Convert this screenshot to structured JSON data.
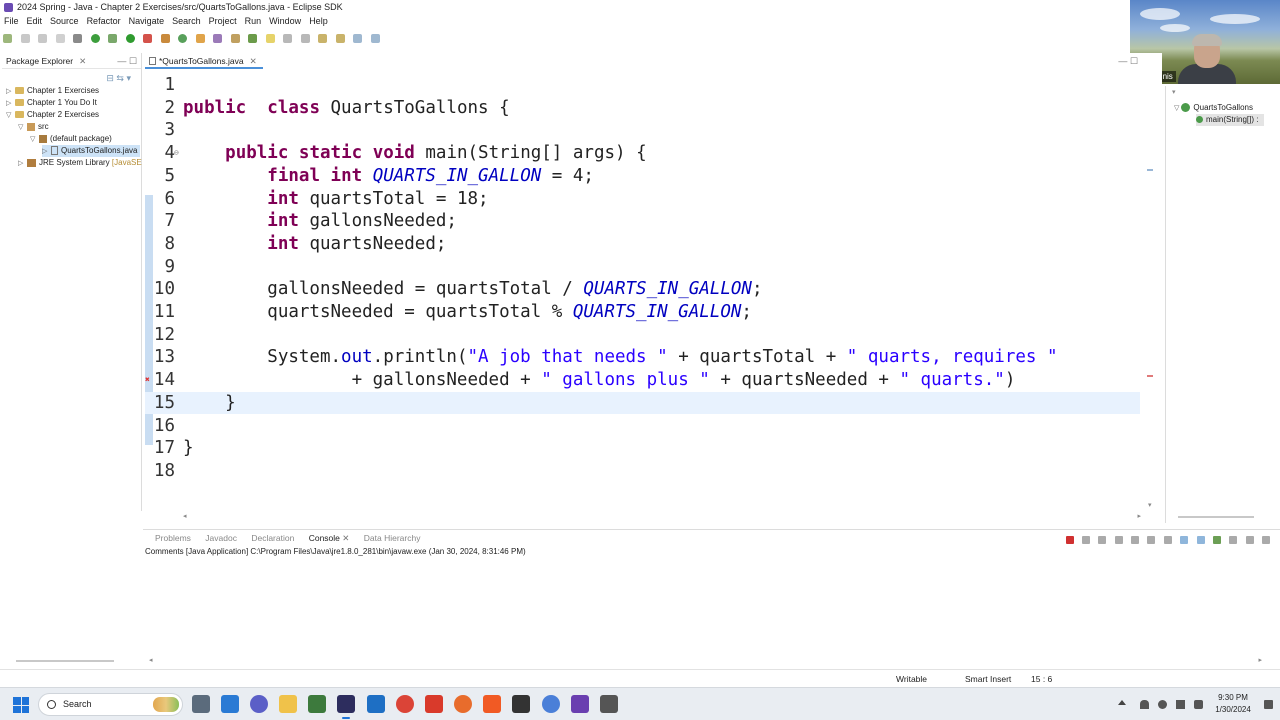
{
  "window": {
    "title": "2024 Spring - Java - Chapter 2 Exercises/src/QuartsToGallons.java - Eclipse SDK"
  },
  "menu": [
    "File",
    "Edit",
    "Source",
    "Refactor",
    "Navigate",
    "Search",
    "Project",
    "Run",
    "Window",
    "Help"
  ],
  "package_explorer": {
    "tab_label": "Package Explorer",
    "items": [
      {
        "label": "Chapter 1 Exercises",
        "suffix": ""
      },
      {
        "label": "Chapter 1 You Do It",
        "suffix": ""
      },
      {
        "label": "Chapter 2 Exercises",
        "suffix": ""
      },
      {
        "label": "src",
        "suffix": ""
      },
      {
        "label": "(default package)",
        "suffix": ""
      },
      {
        "label": "QuartsToGallons.java",
        "suffix": ""
      },
      {
        "label": "JRE System Library",
        "suffix": "[JavaSE"
      }
    ]
  },
  "editor": {
    "tab_label": "*QuartsToGallons.java",
    "lines": [
      {
        "n": "1"
      },
      {
        "n": "2",
        "parts": [
          [
            "kw",
            "public"
          ],
          [
            "",
            "  "
          ],
          [
            "kw",
            "class"
          ],
          [
            "",
            " QuartsToGallons {"
          ]
        ]
      },
      {
        "n": "3"
      },
      {
        "n": "4",
        "parts": [
          [
            "",
            "    "
          ],
          [
            "kw",
            "public"
          ],
          [
            "",
            " "
          ],
          [
            "kw",
            "static"
          ],
          [
            "",
            " "
          ],
          [
            "kw",
            "void"
          ],
          [
            "",
            " main(String[] args) {"
          ]
        ]
      },
      {
        "n": "5",
        "parts": [
          [
            "",
            "        "
          ],
          [
            "kw",
            "final"
          ],
          [
            "",
            " "
          ],
          [
            "kw",
            "int"
          ],
          [
            "",
            " "
          ],
          [
            "cst",
            "QUARTS_IN_GALLON"
          ],
          [
            "",
            " = 4;"
          ]
        ]
      },
      {
        "n": "6",
        "parts": [
          [
            "",
            "        "
          ],
          [
            "kw",
            "int"
          ],
          [
            "",
            " quartsTotal = 18;"
          ]
        ]
      },
      {
        "n": "7",
        "parts": [
          [
            "",
            "        "
          ],
          [
            "kw",
            "int"
          ],
          [
            "",
            " gallonsNeeded;"
          ]
        ]
      },
      {
        "n": "8",
        "parts": [
          [
            "",
            "        "
          ],
          [
            "kw",
            "int"
          ],
          [
            "",
            " quartsNeeded;"
          ]
        ]
      },
      {
        "n": "9"
      },
      {
        "n": "10",
        "parts": [
          [
            "",
            "        gallonsNeeded = quartsTotal / "
          ],
          [
            "cst",
            "QUARTS_IN_GALLON"
          ],
          [
            "",
            ";"
          ]
        ]
      },
      {
        "n": "11",
        "parts": [
          [
            "",
            "        quartsNeeded = quartsTotal % "
          ],
          [
            "cst",
            "QUARTS_IN_GALLON"
          ],
          [
            "",
            ";"
          ]
        ]
      },
      {
        "n": "12"
      },
      {
        "n": "13",
        "parts": [
          [
            "",
            "        System."
          ],
          [
            "fld",
            "out"
          ],
          [
            "",
            ".println("
          ],
          [
            "str",
            "\"A job that needs \""
          ],
          [
            "",
            " + quartsTotal + "
          ],
          [
            "str",
            "\" quarts, requires \""
          ]
        ]
      },
      {
        "n": "14",
        "parts": [
          [
            "",
            "                + gallonsNeeded + "
          ],
          [
            "str",
            "\" gallons plus \""
          ],
          [
            "",
            " + quartsNeeded + "
          ],
          [
            "str",
            "\" quarts.\""
          ],
          [
            "",
            ")"
          ]
        ]
      },
      {
        "n": "15",
        "parts": [
          [
            "",
            "    }"
          ]
        ]
      },
      {
        "n": "16"
      },
      {
        "n": "17",
        "parts": [
          [
            "",
            "}"
          ]
        ]
      },
      {
        "n": "18"
      }
    ]
  },
  "outline": {
    "items": [
      "QuartsToGallons",
      "main(String[]) :"
    ]
  },
  "console": {
    "tabs": [
      "Problems",
      "Javadoc",
      "Declaration",
      "Console",
      "Data Hierarchy"
    ],
    "description": "Comments [Java Application] C:\\Program Files\\Java\\jre1.8.0_281\\bin\\javaw.exe (Jan 30, 2024, 8:31:46 PM)"
  },
  "status": {
    "writable": "Writable",
    "insert_mode": "Smart Insert",
    "position": "15 : 6"
  },
  "webcam": {
    "name": "Takis Kinis"
  },
  "taskbar": {
    "search_label": "Search",
    "time": "9:30 PM",
    "date": "1/30/2024"
  },
  "colors": {
    "keyword": "#7f0055",
    "string": "#2a00ff",
    "constant": "#0000c0",
    "current_line": "#e8f2fe",
    "accent": "#1e73d8"
  }
}
